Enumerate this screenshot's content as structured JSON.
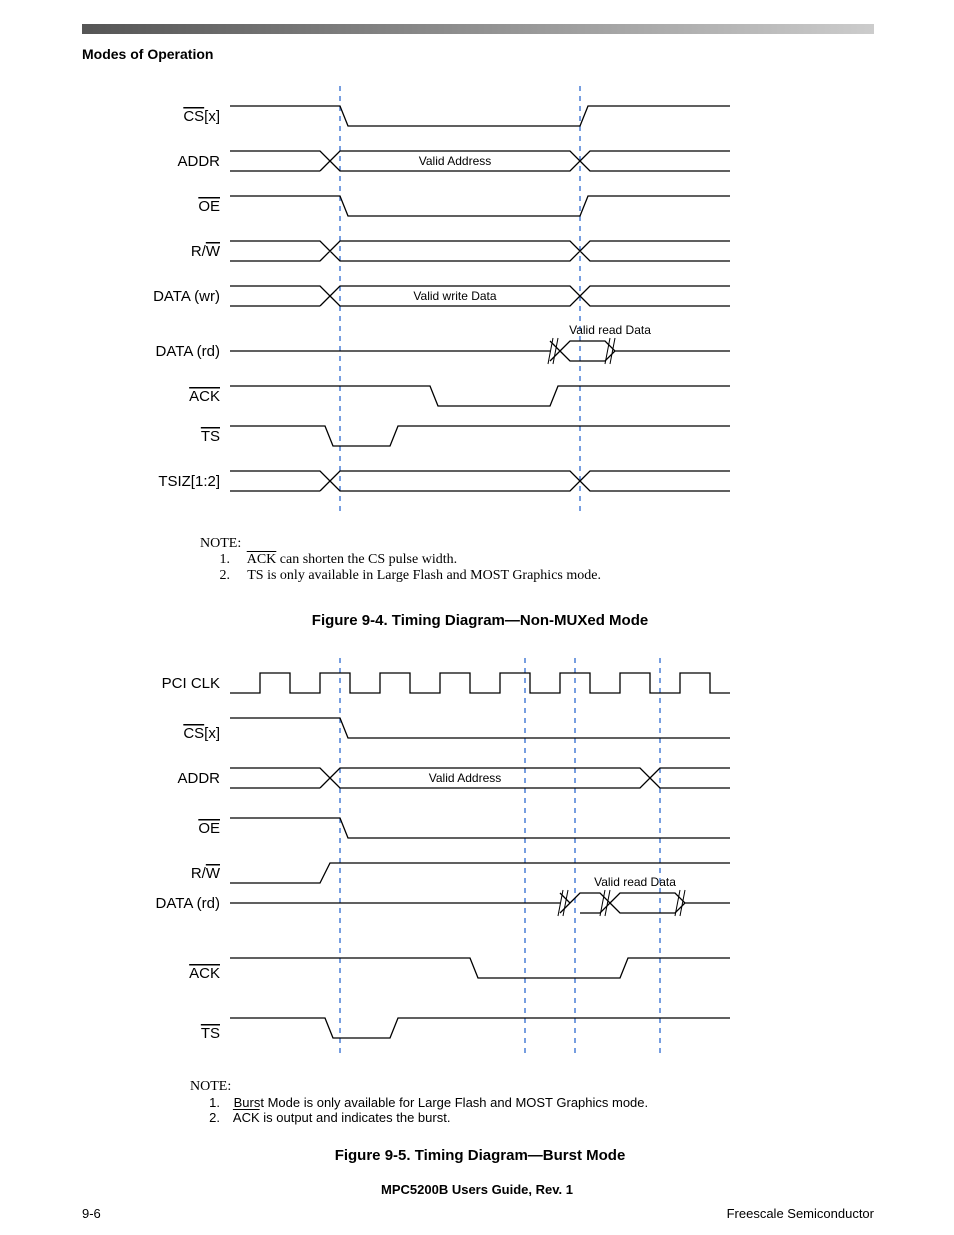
{
  "header": {
    "section": "Modes of Operation"
  },
  "fig1": {
    "signals": {
      "cs": "CS[x]",
      "addr": "ADDR",
      "addr_label": "Valid Address",
      "oe": "OE",
      "rw": "R/W",
      "datawr": "DATA (wr)",
      "datawr_label": "Valid write Data",
      "datard": "DATA (rd)",
      "datard_label": "Valid read Data",
      "ack": "ACK",
      "ts": "TS",
      "tsiz": "TSIZ[1:2]"
    },
    "note_header": "NOTE:",
    "note1_num": "1.",
    "note1_a": "ACK",
    "note1_b": " can shorten the CS pulse width.",
    "note2_num": "2.",
    "note2": "TS is only available in Large Flash and MOST Graphics mode.",
    "caption": "Figure 9-4. Timing Diagram—Non-MUXed Mode"
  },
  "fig2": {
    "signals": {
      "pciclk": "PCI CLK",
      "cs": "CS[x]",
      "addr": "ADDR",
      "addr_label": "Valid Address",
      "oe": "OE",
      "rw": "R/W",
      "datard": "DATA (rd)",
      "datard_label": "Valid read Data",
      "ack": "ACK",
      "ts": "TS"
    },
    "note_header": "NOTE:",
    "note1_num": "1.",
    "note1": "Burst Mode is only available for Large Flash and MOST Graphics mode.",
    "note2_num": "2.",
    "note2_a": "ACK",
    "note2_b": " is output and indicates the burst.",
    "caption": "Figure 9-5. Timing Diagram—Burst Mode"
  },
  "footer": {
    "doc_title": "MPC5200B Users Guide, Rev. 1",
    "page_left": "9-6",
    "page_right": "Freescale Semiconductor"
  }
}
